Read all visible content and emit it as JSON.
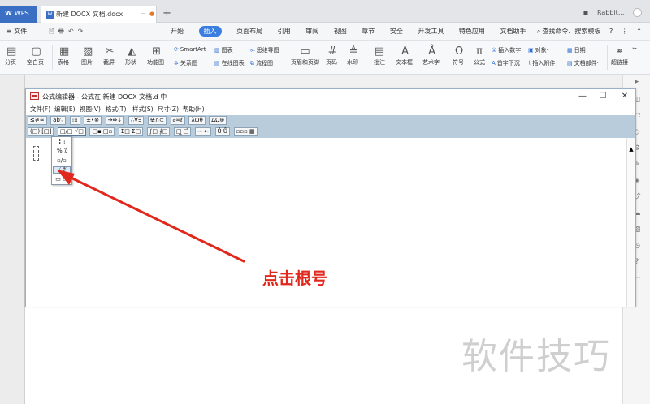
{
  "titlebar": {
    "wps_label": "WPS",
    "doc_tab_title": "新建 DOCX 文档.docx",
    "new_tab": "+",
    "user_name": "Rabbit..."
  },
  "menu": {
    "file": "≡ 文件",
    "quick_icons": "🗎🖶↶↷",
    "tabs": [
      "开始",
      "插入",
      "页面布局",
      "引用",
      "审阅",
      "视图",
      "章节",
      "安全",
      "开发工具",
      "特色应用",
      "文档助手"
    ],
    "active_tab": "插入",
    "search": "查找命令、搜索模板",
    "help": "?"
  },
  "toolbar": {
    "items": {
      "page_break": "分页",
      "blank_page": "空白页",
      "table": "表格",
      "picture": "图片",
      "screenshot": "截屏",
      "shape": "形状",
      "function_chart": "功能图",
      "smartart": "SmartArt",
      "chart": "图表",
      "mind_map": "思维导图",
      "relation_chart": "关系图",
      "online_chart": "在线图表",
      "flowchart": "流程图",
      "header_footer": "页眉和页脚",
      "page_number": "页码",
      "watermark": "水印",
      "comment": "批注",
      "textbox": "文本框",
      "wordart": "艺术字",
      "symbol": "符号",
      "formula": "公式",
      "insert_number": "插入数字",
      "drop_cap": "首字下沉",
      "object": "对象",
      "attachment": "插入附件",
      "date": "日期",
      "doc_parts": "文档部件",
      "hyperlink": "超链接"
    }
  },
  "equation_editor": {
    "title": "公式编辑器 - 公式在 新建 DOCX 文档.d 中",
    "menus": [
      "文件(F)",
      "编辑(E)",
      "视图(V)",
      "格式(T)",
      "样式(S)",
      "尺寸(Z)",
      "帮助(H)"
    ],
    "palette_row1": [
      "≤≠≈",
      "ạb∵",
      "⁞⁞⁞",
      "±•⊗",
      "→⇔↓",
      "∴∀∃",
      "∉∩⊂",
      "∂∞ℓ",
      "λωθ",
      "ΔΩ⊛"
    ],
    "palette_row2": [
      "(□) [□]",
      "□/□ √□",
      "□▪ □▫",
      "Σ□ Σ□",
      "∫□ ∮□",
      "□̲ □̄",
      "→ ←",
      "Ů Ů",
      "▫▫▫ ▦"
    ],
    "dropdown_items": [
      "╏ ⁞",
      "%  ⁒",
      "▫/▫",
      "√  ∜",
      "▭  ▭"
    ],
    "highlighted_item": "√  ∜"
  },
  "annotation": {
    "text": "点击根号"
  },
  "watermark_text": "软件技巧",
  "colors": {
    "accent": "#3a7fe0",
    "annotation_red": "#e0281d",
    "palette_bg": "#b9ccdc"
  }
}
